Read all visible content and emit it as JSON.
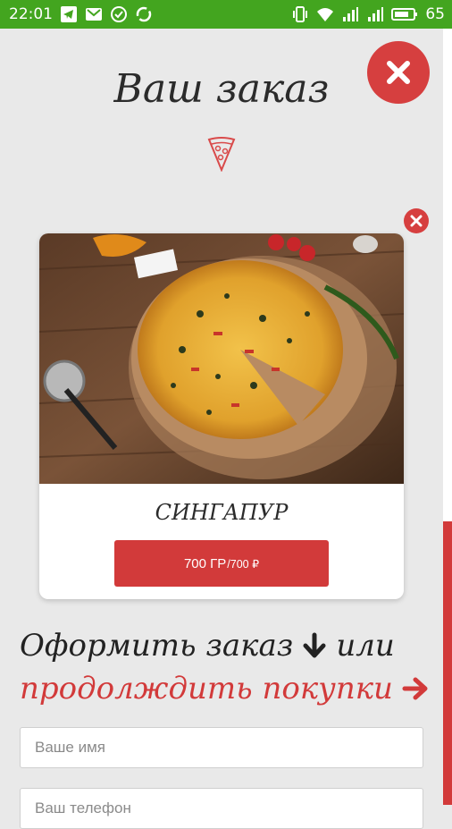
{
  "statusbar": {
    "time": "22:01",
    "battery": "65",
    "left_icons": [
      "telegram-icon",
      "mail-icon",
      "check-circle-icon",
      "sync-icon"
    ],
    "right_icons": [
      "vibrate-icon",
      "wifi-icon",
      "signal-1-icon",
      "signal-2-icon",
      "battery-icon"
    ],
    "color": "#43a51f"
  },
  "page": {
    "title": "Ваш заказ",
    "close_icon": "close-icon",
    "accent_color": "#d23a3a"
  },
  "cart": {
    "items": [
      {
        "name": "СИНГАПУР",
        "weight": "700 ГР",
        "price": "/700 ₽",
        "image": "pizza-photo",
        "remove_icon": "close-icon"
      }
    ]
  },
  "checkout": {
    "line1": "Оформить заказ",
    "or": "или",
    "continue": "продолждить покупки",
    "name_placeholder": "Ваше имя",
    "phone_placeholder": "Ваш телефон"
  }
}
